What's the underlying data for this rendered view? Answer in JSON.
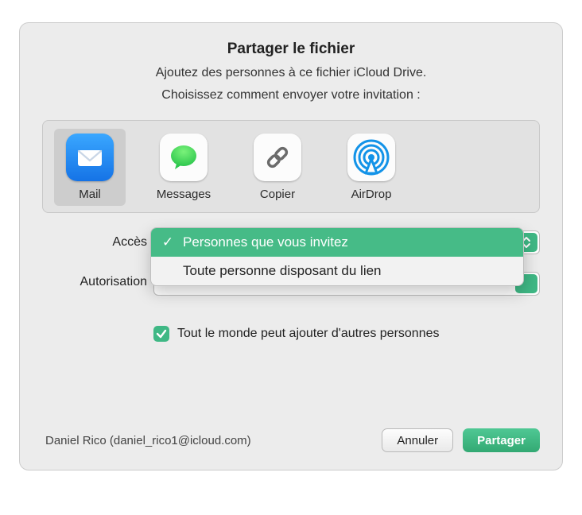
{
  "dialog": {
    "title": "Partager le fichier",
    "subtitle": "Ajoutez des personnes à ce fichier iCloud Drive.",
    "instruction": "Choisissez comment envoyer votre invitation :"
  },
  "apps": [
    {
      "label": "Mail",
      "icon": "mail-icon",
      "selected": true
    },
    {
      "label": "Messages",
      "icon": "messages-icon",
      "selected": false
    },
    {
      "label": "Copier",
      "icon": "link-icon",
      "selected": false
    },
    {
      "label": "AirDrop",
      "icon": "airdrop-icon",
      "selected": false
    }
  ],
  "access": {
    "label": "Accès",
    "options": [
      "Personnes que vous invitez",
      "Toute personne disposant du lien"
    ],
    "selected_index": 0
  },
  "permission": {
    "label": "Autorisation"
  },
  "checkbox": {
    "checked": true,
    "label": "Tout le monde peut ajouter d'autres personnes"
  },
  "user": "Daniel Rico (daniel_rico1@icloud.com)",
  "buttons": {
    "cancel": "Annuler",
    "share": "Partager"
  }
}
